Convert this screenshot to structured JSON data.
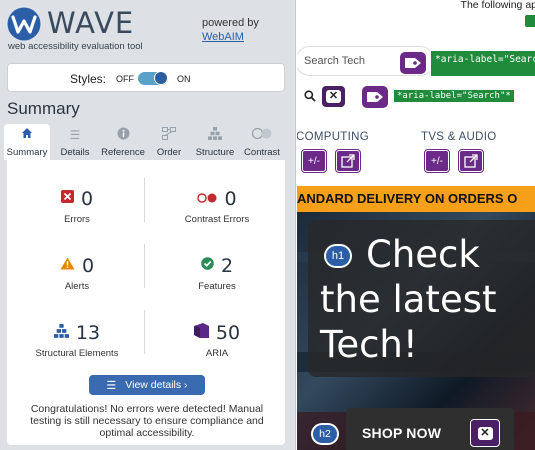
{
  "wave": {
    "logo_text": "WAVE",
    "tagline": "web accessibility evaluation tool",
    "powered_by": "powered by",
    "powered_link": "WebAIM",
    "styles_label": "Styles:",
    "styles_off": "OFF",
    "styles_on": "ON",
    "styles_enabled": true,
    "summary_title": "Summary",
    "tabs": [
      {
        "label": "Summary",
        "icon": "home-icon",
        "active": true
      },
      {
        "label": "Details",
        "icon": "list-icon",
        "active": false
      },
      {
        "label": "Reference",
        "icon": "info-icon",
        "active": false
      },
      {
        "label": "Order",
        "icon": "order-icon",
        "active": false
      },
      {
        "label": "Structure",
        "icon": "structure-icon",
        "active": false
      },
      {
        "label": "Contrast",
        "icon": "contrast-icon",
        "active": false
      }
    ],
    "stats": {
      "errors": {
        "value": "0",
        "label": "Errors",
        "icon": "error-icon"
      },
      "contrast_errors": {
        "value": "0",
        "label": "Contrast Errors",
        "icon": "contrast-error-icon"
      },
      "alerts": {
        "value": "0",
        "label": "Alerts",
        "icon": "alert-icon"
      },
      "features": {
        "value": "2",
        "label": "Features",
        "icon": "feature-icon"
      },
      "structural": {
        "value": "13",
        "label": "Structural Elements",
        "icon": "structure-icon"
      },
      "aria": {
        "value": "50",
        "label": "ARIA",
        "icon": "aria-icon"
      }
    },
    "view_details": "View details ›",
    "congrats": "Congratulations! No errors were detected! Manual testing is still necessary to ensure compliance and optimal accessibility."
  },
  "site": {
    "top_text": "The following ap",
    "search_placeholder": "Search Tech",
    "aria_label_1": "*aria-label=\"Search\"*",
    "aria_label_2": "*aria-label=\"Search\"*",
    "categories": [
      "COMPUTING",
      "TVS & AUDIO"
    ],
    "banner": "ANDARD DELIVERY ON ORDERS O",
    "h1_badge": "h1",
    "hero_line1": "Check",
    "hero_line2": "the latest",
    "hero_line3": "Tech!",
    "h2_badge": "h2",
    "shop_now": "SHOP NOW"
  },
  "colors": {
    "wave_blue": "#2c5ea8",
    "aria_purple": "#6b2a88",
    "aria_green": "#1f8b3b",
    "banner_orange": "#f6a01a",
    "error_red": "#c5282f",
    "alert_orange": "#e08a00",
    "feature_green": "#2e8b57"
  }
}
